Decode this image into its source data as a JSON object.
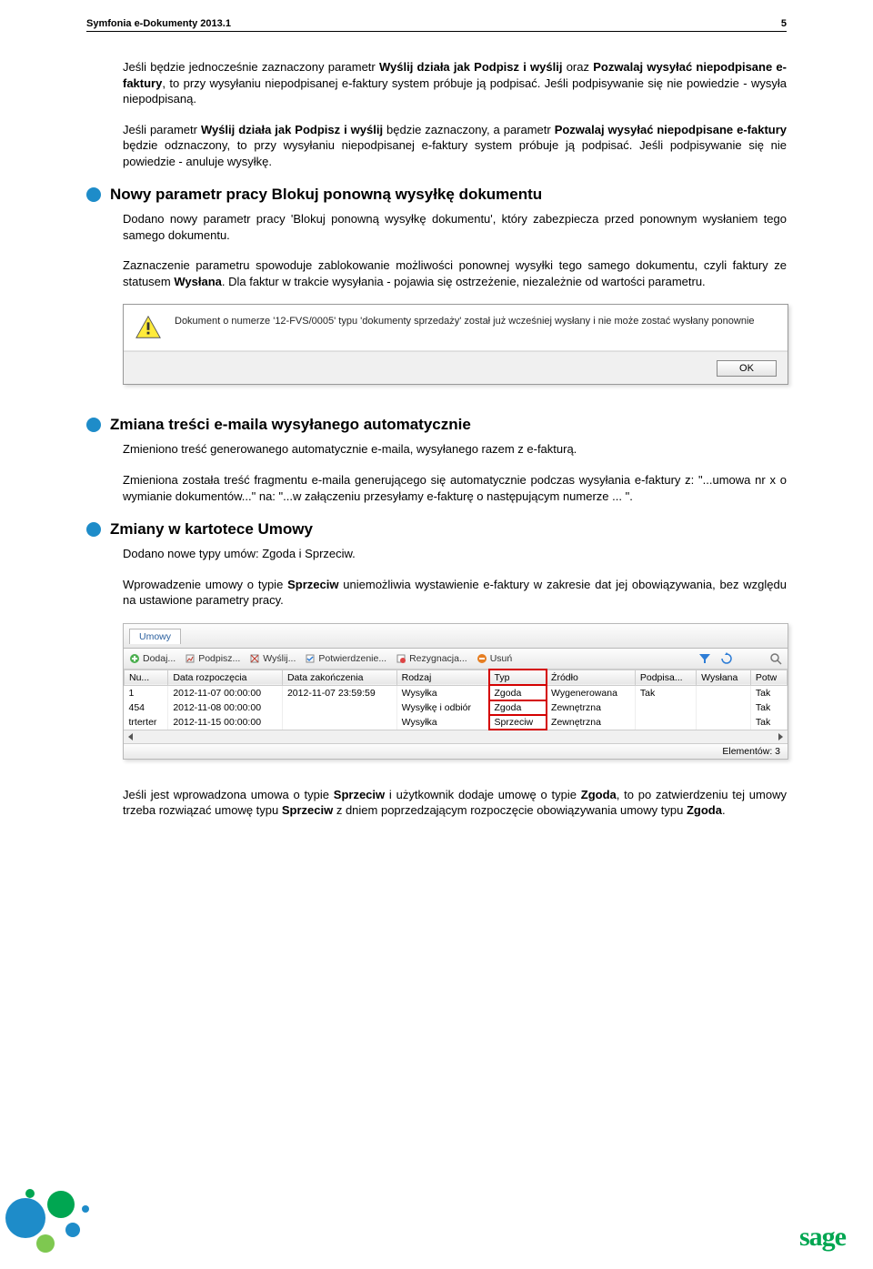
{
  "header": {
    "title": "Symfonia e-Dokumenty 2013.1",
    "page": "5"
  },
  "p1": {
    "a": "Jeśli będzie jednocześnie zaznaczony parametr ",
    "wyslij": "Wyślij działa jak Podpisz i wyślij",
    "b": " oraz ",
    "pozwalaj": "Pozwalaj wysyłać niepodpisane e-faktury",
    "c": ", to przy wysyłaniu niepodpisanej e-faktury system próbuje ją podpisać. Jeśli podpisywanie się nie powiedzie - wysyła niepodpisaną."
  },
  "p2": {
    "a": "Jeśli parametr ",
    "wyslij": "Wyślij działa jak Podpisz i wyślij",
    "b": " będzie zaznaczony, a parametr ",
    "pozwalaj": "Pozwalaj wysyłać niepodpisane e-faktury",
    "c": " będzie odznaczony, to przy wysyłaniu niepodpisanej e-faktury system próbuje ją podpisać. Jeśli podpisywanie się nie powiedzie -  anuluje wysyłkę."
  },
  "s1": {
    "heading": "Nowy parametr pracy Blokuj ponowną wysyłkę dokumentu",
    "p1": "Dodano nowy parametr pracy 'Blokuj ponowną wysyłkę dokumentu', który zabezpiecza przed ponownym wysłaniem tego samego dokumentu.",
    "p2a": "Zaznaczenie parametru spowoduje zablokowanie możliwości ponownej wysyłki tego samego dokumentu, czyli faktury ze statusem ",
    "wyslana": "Wysłana",
    "p2b": ". Dla faktur w trakcie wysyłania - pojawia się ostrzeżenie, niezależnie od wartości parametru.",
    "dialog_msg": "Dokument o numerze '12-FVS/0005' typu 'dokumenty sprzedaży' został już wcześniej wysłany i nie może zostać wysłany ponownie",
    "ok": "OK"
  },
  "s2": {
    "heading": "Zmiana treści e-maila wysyłanego automatycznie",
    "p1": "Zmieniono treść generowanego automatycznie e-maila, wysyłanego razem z e-fakturą.",
    "p2": "Zmieniona została treść fragmentu e-maila generującego się automatycznie podczas wysyłania e-faktury z: \"...umowa nr x o wymianie dokumentów...\" na:  \"...w załączeniu przesyłamy e-fakturę o następującym numerze ... \"."
  },
  "s3": {
    "heading": "Zmiany w kartotece Umowy",
    "p1": "Dodano nowe typy umów: Zgoda i Sprzeciw.",
    "p2a": "Wprowadzenie umowy o typie ",
    "sprzeciw": "Sprzeciw",
    "p2b": " uniemożliwia wystawienie e-faktury w zakresie dat jej obowiązywania, bez względu na ustawione parametry pracy."
  },
  "grid": {
    "tab": "Umowy",
    "toolbar": {
      "dodaj": "Dodaj...",
      "podpisz": "Podpisz...",
      "wyslij": "Wyślij...",
      "potwierdzenie": "Potwierdzenie...",
      "rezygnacja": "Rezygnacja...",
      "usun": "Usuń"
    },
    "cols": [
      "Nu...",
      "Data rozpoczęcia",
      "Data zakończenia",
      "Rodzaj",
      "Typ",
      "Źródło",
      "Podpisa...",
      "Wysłana",
      "Potw"
    ],
    "rows": [
      {
        "nu": "1",
        "dr": "2012-11-07 00:00:00",
        "dz": "2012-11-07 23:59:59",
        "rodzaj": "Wysyłka",
        "typ": "Zgoda",
        "zrodlo": "Wygenerowana",
        "pod": "Tak",
        "wys": "",
        "potw": "Tak"
      },
      {
        "nu": "454",
        "dr": "2012-11-08 00:00:00",
        "dz": "",
        "rodzaj": "Wysyłkę i odbiór",
        "typ": "Zgoda",
        "zrodlo": "Zewnętrzna",
        "pod": "",
        "wys": "",
        "potw": "Tak"
      },
      {
        "nu": "trterter",
        "dr": "2012-11-15 00:00:00",
        "dz": "",
        "rodzaj": "Wysyłka",
        "typ": "Sprzeciw",
        "zrodlo": "Zewnętrzna",
        "pod": "",
        "wys": "",
        "potw": "Tak"
      }
    ],
    "footer": "Elementów: 3"
  },
  "p_after_grid": {
    "a": "Jeśli jest wprowadzona umowa o typie ",
    "sprzeciw": "Sprzeciw",
    "b": " i użytkownik dodaje umowę o typie ",
    "zgoda": "Zgoda",
    "c": ", to po zatwierdzeniu tej umowy trzeba rozwiązać umowę typu ",
    "sprzeciw2": "Sprzeciw",
    "d": " z dniem poprzedzającym rozpoczęcie obowiązywania umowy typu ",
    "zgoda2": "Zgoda",
    "e": "."
  },
  "logo": "sage"
}
